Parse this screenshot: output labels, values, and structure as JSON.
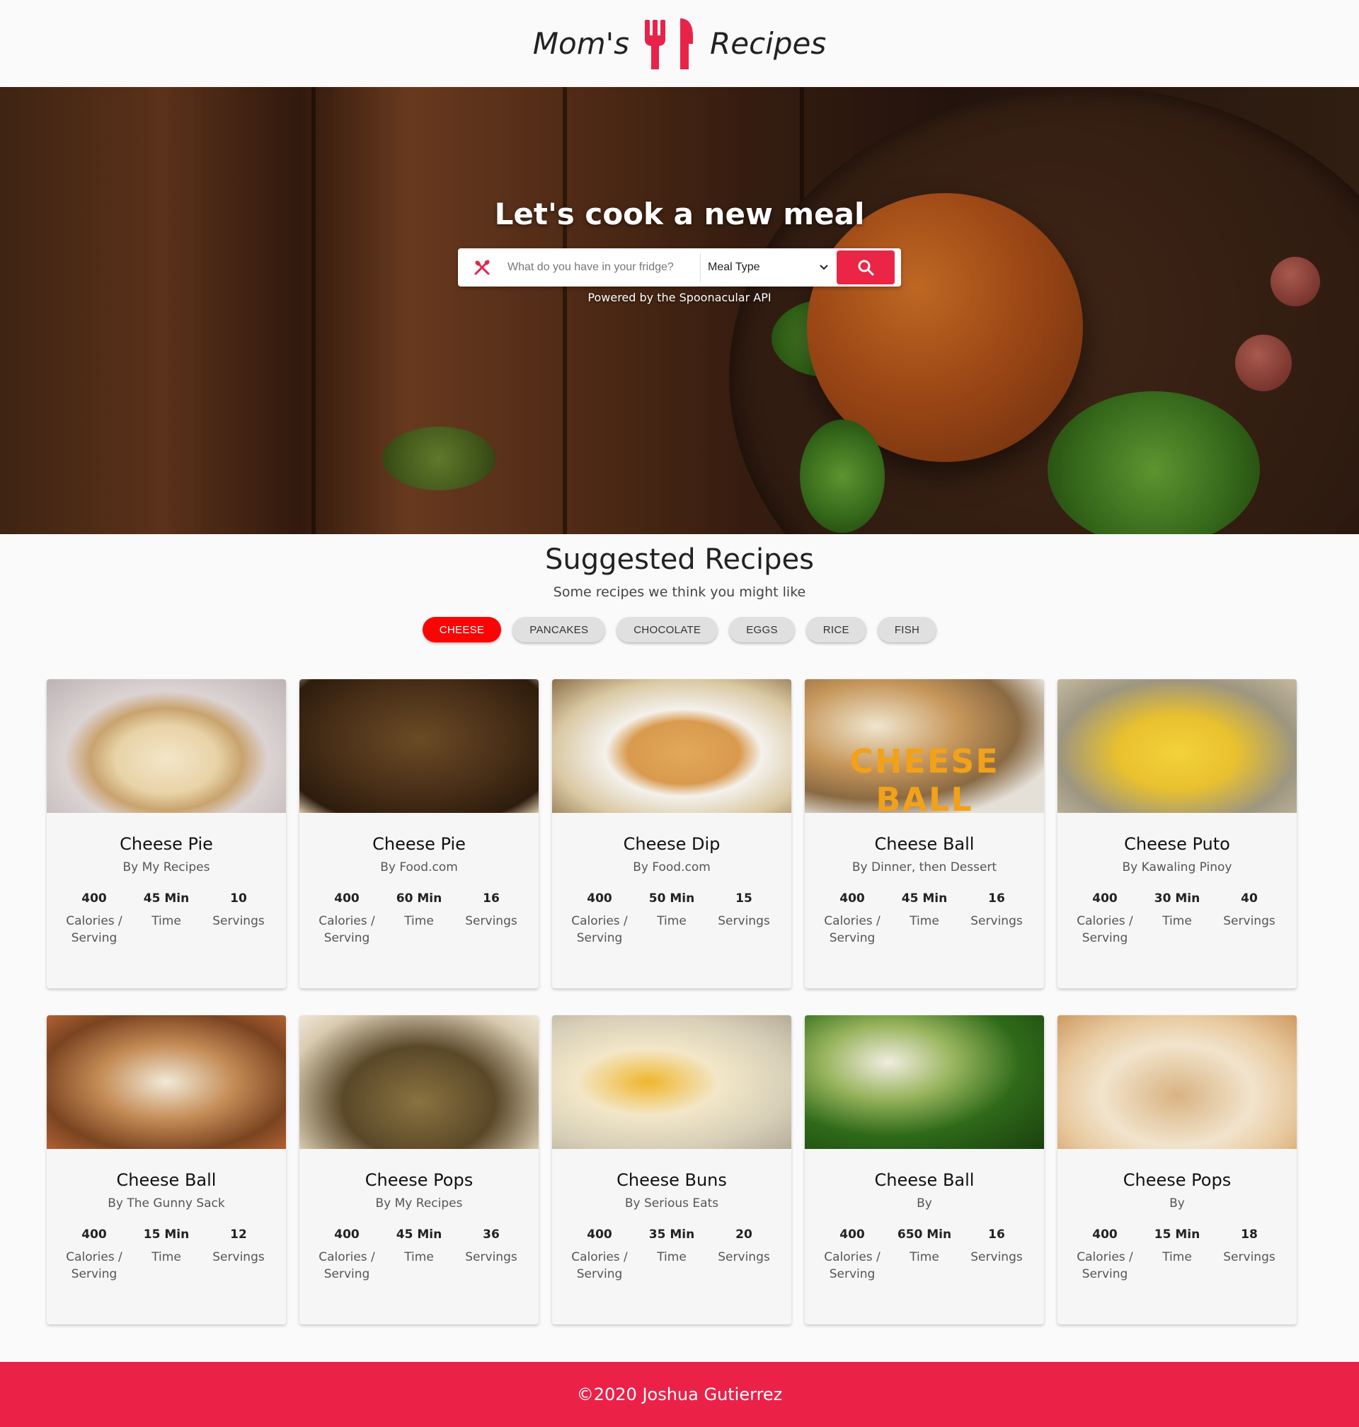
{
  "header": {
    "brand_left": "Mom's",
    "brand_right": "Recipes",
    "logo_icon": "fork-knife-icon",
    "accent": "#eb2545"
  },
  "hero": {
    "title": "Let's cook a new meal",
    "search_placeholder": "What do you have in your fridge?",
    "meal_type_selected": "Meal Type",
    "powered_by": "Powered by the Spoonacular API"
  },
  "suggested": {
    "title": "Suggested Recipes",
    "subtitle": "Some recipes we think you might like",
    "chips": [
      "CHEESE",
      "PANCAKES",
      "CHOCOLATE",
      "EGGS",
      "RICE",
      "FISH"
    ],
    "active_chip": "CHEESE"
  },
  "stat_labels": {
    "calories": "Calories / Serving",
    "time": "Time",
    "servings": "Servings"
  },
  "recipes": [
    {
      "title": "Cheese Pie",
      "by": "By My Recipes",
      "calories": "400",
      "time": "45 Min",
      "servings": "10"
    },
    {
      "title": "Cheese Pie",
      "by": "By Food.com",
      "calories": "400",
      "time": "60 Min",
      "servings": "16"
    },
    {
      "title": "Cheese Dip",
      "by": "By Food.com",
      "calories": "400",
      "time": "50 Min",
      "servings": "15"
    },
    {
      "title": "Cheese Ball",
      "by": "By Dinner, then Dessert",
      "calories": "400",
      "time": "45 Min",
      "servings": "16",
      "image_text": "CHEESE BALL"
    },
    {
      "title": "Cheese Puto",
      "by": "By Kawaling Pinoy",
      "calories": "400",
      "time": "30 Min",
      "servings": "40"
    },
    {
      "title": "Cheese Ball",
      "by": "By The Gunny Sack",
      "calories": "400",
      "time": "15 Min",
      "servings": "12"
    },
    {
      "title": "Cheese Pops",
      "by": "By My Recipes",
      "calories": "400",
      "time": "45 Min",
      "servings": "36"
    },
    {
      "title": "Cheese Buns",
      "by": "By Serious Eats",
      "calories": "400",
      "time": "35 Min",
      "servings": "20"
    },
    {
      "title": "Cheese Ball",
      "by": "By",
      "calories": "400",
      "time": "650 Min",
      "servings": "16"
    },
    {
      "title": "Cheese Pops",
      "by": "By",
      "calories": "400",
      "time": "15 Min",
      "servings": "18"
    }
  ],
  "footer": {
    "text": "©2020 Joshua Gutierrez",
    "color": "#eb2148"
  }
}
